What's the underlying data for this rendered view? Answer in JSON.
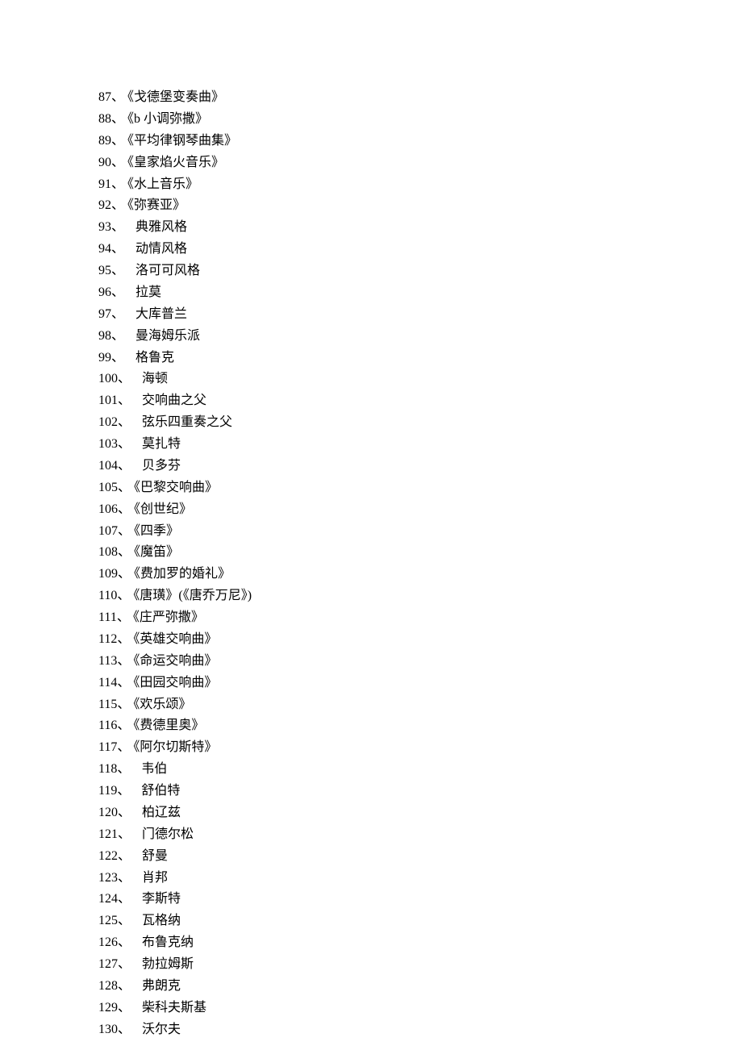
{
  "items": [
    {
      "num": "87",
      "sep": "、",
      "text": "《戈德堡变奏曲》",
      "wide": false
    },
    {
      "num": "88",
      "sep": "、",
      "text": "《b 小调弥撒》",
      "wide": false
    },
    {
      "num": "89",
      "sep": "、",
      "text": "《平均律钢琴曲集》",
      "wide": false
    },
    {
      "num": "90",
      "sep": "、",
      "text": "《皇家焰火音乐》",
      "wide": false
    },
    {
      "num": "91",
      "sep": "、",
      "text": "《水上音乐》",
      "wide": false
    },
    {
      "num": "92",
      "sep": "、",
      "text": "《弥赛亚》",
      "wide": false
    },
    {
      "num": "93",
      "sep": "、",
      "text": "典雅风格",
      "wide": true
    },
    {
      "num": "94",
      "sep": "、",
      "text": "动情风格",
      "wide": true
    },
    {
      "num": "95",
      "sep": "、",
      "text": "洛可可风格",
      "wide": true
    },
    {
      "num": "96",
      "sep": "、",
      "text": "拉莫",
      "wide": true
    },
    {
      "num": "97",
      "sep": "、",
      "text": "大库普兰",
      "wide": true
    },
    {
      "num": "98",
      "sep": "、",
      "text": "曼海姆乐派",
      "wide": true
    },
    {
      "num": "99",
      "sep": "、",
      "text": "格鲁克",
      "wide": true
    },
    {
      "num": "100",
      "sep": "、",
      "text": "海顿",
      "wide": true
    },
    {
      "num": "101",
      "sep": "、",
      "text": "交响曲之父",
      "wide": true
    },
    {
      "num": "102",
      "sep": "、",
      "text": "弦乐四重奏之父",
      "wide": true
    },
    {
      "num": "103",
      "sep": "、",
      "text": "莫扎特",
      "wide": true
    },
    {
      "num": "104",
      "sep": "、",
      "text": "贝多芬",
      "wide": true
    },
    {
      "num": "105",
      "sep": "、",
      "text": "《巴黎交响曲》",
      "wide": false
    },
    {
      "num": "106",
      "sep": "、",
      "text": "《创世纪》",
      "wide": false
    },
    {
      "num": "107",
      "sep": "、",
      "text": "《四季》",
      "wide": false
    },
    {
      "num": "108",
      "sep": "、",
      "text": "《魔笛》",
      "wide": false
    },
    {
      "num": "109",
      "sep": "、",
      "text": "《费加罗的婚礼》",
      "wide": false
    },
    {
      "num": "110",
      "sep": "、",
      "text": "《唐璜》(《唐乔万尼》)",
      "wide": false
    },
    {
      "num": "111",
      "sep": "、",
      "text": "《庄严弥撒》",
      "wide": false
    },
    {
      "num": "112",
      "sep": "、",
      "text": "《英雄交响曲》",
      "wide": false
    },
    {
      "num": "113",
      "sep": "、",
      "text": "《命运交响曲》",
      "wide": false
    },
    {
      "num": "114",
      "sep": "、",
      "text": "《田园交响曲》",
      "wide": false
    },
    {
      "num": "115",
      "sep": "、",
      "text": "《欢乐颂》",
      "wide": false
    },
    {
      "num": "116",
      "sep": "、",
      "text": "《费德里奥》",
      "wide": false
    },
    {
      "num": "117",
      "sep": "、",
      "text": "《阿尔切斯特》",
      "wide": false
    },
    {
      "num": "118",
      "sep": "、",
      "text": "韦伯",
      "wide": true
    },
    {
      "num": "119",
      "sep": "、",
      "text": "舒伯特",
      "wide": true
    },
    {
      "num": "120",
      "sep": "、",
      "text": "柏辽兹",
      "wide": true
    },
    {
      "num": "121",
      "sep": "、",
      "text": "门德尔松",
      "wide": true
    },
    {
      "num": "122",
      "sep": "、",
      "text": "舒曼",
      "wide": true
    },
    {
      "num": "123",
      "sep": "、",
      "text": "肖邦",
      "wide": true
    },
    {
      "num": "124",
      "sep": "、",
      "text": "李斯特",
      "wide": true
    },
    {
      "num": "125",
      "sep": "、",
      "text": "瓦格纳",
      "wide": true
    },
    {
      "num": "126",
      "sep": "、",
      "text": "布鲁克纳",
      "wide": true
    },
    {
      "num": "127",
      "sep": "、",
      "text": "勃拉姆斯",
      "wide": true
    },
    {
      "num": "128",
      "sep": "、",
      "text": "弗朗克",
      "wide": true
    },
    {
      "num": "129",
      "sep": "、",
      "text": "柴科夫斯基",
      "wide": true
    },
    {
      "num": "130",
      "sep": "、",
      "text": "沃尔夫",
      "wide": true
    }
  ]
}
